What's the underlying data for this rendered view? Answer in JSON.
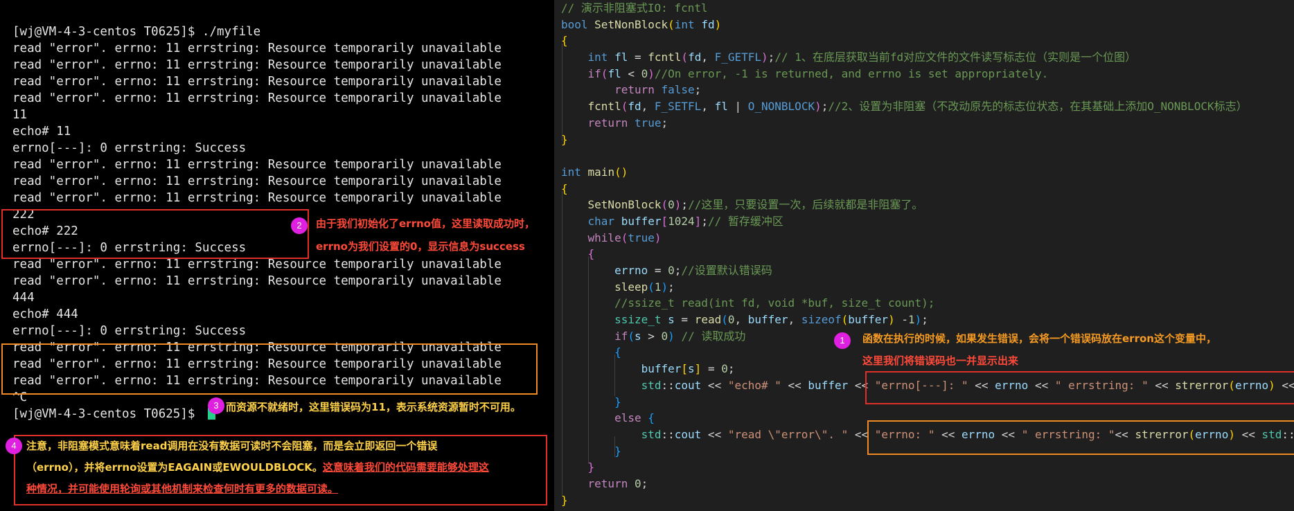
{
  "terminal": {
    "lines": [
      "[wj@VM-4-3-centos T0625]$ ./myfile",
      "read \"error\". errno: 11 errstring: Resource temporarily unavailable",
      "read \"error\". errno: 11 errstring: Resource temporarily unavailable",
      "read \"error\". errno: 11 errstring: Resource temporarily unavailable",
      "read \"error\". errno: 11 errstring: Resource temporarily unavailable",
      "11",
      "echo# 11",
      "errno[---]: 0 errstring: Success",
      "read \"error\". errno: 11 errstring: Resource temporarily unavailable",
      "read \"error\". errno: 11 errstring: Resource temporarily unavailable",
      "read \"error\". errno: 11 errstring: Resource temporarily unavailable",
      "222",
      "echo# 222",
      "errno[---]: 0 errstring: Success",
      "read \"error\". errno: 11 errstring: Resource temporarily unavailable",
      "read \"error\". errno: 11 errstring: Resource temporarily unavailable",
      "444",
      "echo# 444",
      "errno[---]: 0 errstring: Success",
      "read \"error\". errno: 11 errstring: Resource temporarily unavailable",
      "read \"error\". errno: 11 errstring: Resource temporarily unavailable",
      "read \"error\". errno: 11 errstring: Resource temporarily unavailable",
      "^C",
      "[wj@VM-4-3-centos T0625]$ "
    ]
  },
  "code": {
    "lines": [
      [
        [
          "cm",
          "// 演示非阻塞式IO: fcntl"
        ]
      ],
      [
        [
          "kw",
          "bool"
        ],
        [
          "t",
          " "
        ],
        [
          "fn",
          "SetNonBlock"
        ],
        [
          "br1",
          "("
        ],
        [
          "kw",
          "int"
        ],
        [
          "t",
          " "
        ],
        [
          "var",
          "fd"
        ],
        [
          "br1",
          ")"
        ]
      ],
      [
        [
          "br1",
          "{"
        ]
      ],
      [
        [
          "t",
          "    "
        ],
        [
          "kw",
          "int"
        ],
        [
          "t",
          " "
        ],
        [
          "var",
          "fl"
        ],
        [
          "t",
          " = "
        ],
        [
          "fn",
          "fcntl"
        ],
        [
          "br2",
          "("
        ],
        [
          "var",
          "fd"
        ],
        [
          "t",
          ", "
        ],
        [
          "mac",
          "F_GETFL"
        ],
        [
          "br2",
          ")"
        ],
        [
          "t",
          ";"
        ],
        [
          "cm",
          "// 1、在底层获取当前fd对应文件的文件读写标志位（实则是一个位图）"
        ]
      ],
      [
        [
          "t",
          "    "
        ],
        [
          "ctl",
          "if"
        ],
        [
          "br2",
          "("
        ],
        [
          "var",
          "fl"
        ],
        [
          "t",
          " < "
        ],
        [
          "num",
          "0"
        ],
        [
          "br2",
          ")"
        ],
        [
          "cm",
          "//On error, -1 is returned, and errno is set appropriately."
        ]
      ],
      [
        [
          "t",
          "        "
        ],
        [
          "ctl",
          "return"
        ],
        [
          "t",
          " "
        ],
        [
          "kw",
          "false"
        ],
        [
          "t",
          ";"
        ]
      ],
      [
        [
          "t",
          "    "
        ],
        [
          "fn",
          "fcntl"
        ],
        [
          "br2",
          "("
        ],
        [
          "var",
          "fd"
        ],
        [
          "t",
          ", "
        ],
        [
          "mac",
          "F_SETFL"
        ],
        [
          "t",
          ", "
        ],
        [
          "var",
          "fl"
        ],
        [
          "t",
          " | "
        ],
        [
          "mac",
          "O_NONBLOCK"
        ],
        [
          "br2",
          ")"
        ],
        [
          "t",
          ";"
        ],
        [
          "cm",
          "//2、设置为非阻塞（不改动原先的标志位状态，在其基础上添加O_NONBLOCK标志）"
        ]
      ],
      [
        [
          "t",
          "    "
        ],
        [
          "ctl",
          "return"
        ],
        [
          "t",
          " "
        ],
        [
          "kw",
          "true"
        ],
        [
          "t",
          ";"
        ]
      ],
      [
        [
          "br1",
          "}"
        ]
      ],
      [
        [
          "t",
          ""
        ]
      ],
      [
        [
          "kw",
          "int"
        ],
        [
          "t",
          " "
        ],
        [
          "fn",
          "main"
        ],
        [
          "br1",
          "()"
        ]
      ],
      [
        [
          "br1",
          "{"
        ]
      ],
      [
        [
          "t",
          "    "
        ],
        [
          "fn",
          "SetNonBlock"
        ],
        [
          "br2",
          "("
        ],
        [
          "num",
          "0"
        ],
        [
          "br2",
          ")"
        ],
        [
          "t",
          ";"
        ],
        [
          "cm",
          "//这里，只要设置一次，后续就都是非阻塞了。"
        ]
      ],
      [
        [
          "t",
          "    "
        ],
        [
          "kw",
          "char"
        ],
        [
          "t",
          " "
        ],
        [
          "var",
          "buffer"
        ],
        [
          "br2",
          "["
        ],
        [
          "num",
          "1024"
        ],
        [
          "br2",
          "]"
        ],
        [
          "t",
          ";"
        ],
        [
          "cm",
          "// 暂存缓冲区"
        ]
      ],
      [
        [
          "t",
          "    "
        ],
        [
          "ctl",
          "while"
        ],
        [
          "br2",
          "("
        ],
        [
          "kw",
          "true"
        ],
        [
          "br2",
          ")"
        ]
      ],
      [
        [
          "t",
          "    "
        ],
        [
          "br2",
          "{"
        ]
      ],
      [
        [
          "t",
          "        "
        ],
        [
          "var",
          "errno"
        ],
        [
          "t",
          " = "
        ],
        [
          "num",
          "0"
        ],
        [
          "t",
          ";"
        ],
        [
          "cm",
          "//设置默认错误码"
        ]
      ],
      [
        [
          "t",
          "        "
        ],
        [
          "fn",
          "sleep"
        ],
        [
          "br3",
          "("
        ],
        [
          "num",
          "1"
        ],
        [
          "br3",
          ")"
        ],
        [
          "t",
          ";"
        ]
      ],
      [
        [
          "t",
          "        "
        ],
        [
          "cm",
          "//ssize_t read(int fd, void *buf, size_t count);"
        ]
      ],
      [
        [
          "t",
          "        "
        ],
        [
          "ty",
          "ssize_t"
        ],
        [
          "t",
          " "
        ],
        [
          "var",
          "s"
        ],
        [
          "t",
          " = "
        ],
        [
          "fn",
          "read"
        ],
        [
          "br3",
          "("
        ],
        [
          "num",
          "0"
        ],
        [
          "t",
          ", "
        ],
        [
          "var",
          "buffer"
        ],
        [
          "t",
          ", "
        ],
        [
          "kw",
          "sizeof"
        ],
        [
          "br1",
          "("
        ],
        [
          "var",
          "buffer"
        ],
        [
          "br1",
          ")"
        ],
        [
          "t",
          " -"
        ],
        [
          "num",
          "1"
        ],
        [
          "br3",
          ")"
        ],
        [
          "t",
          ";"
        ]
      ],
      [
        [
          "t",
          "        "
        ],
        [
          "ctl",
          "if"
        ],
        [
          "br3",
          "("
        ],
        [
          "var",
          "s"
        ],
        [
          "t",
          " > "
        ],
        [
          "num",
          "0"
        ],
        [
          "br3",
          ")"
        ],
        [
          "t",
          " "
        ],
        [
          "cm",
          "// 读取成功"
        ]
      ],
      [
        [
          "t",
          "        "
        ],
        [
          "br3",
          "{"
        ]
      ],
      [
        [
          "t",
          "            "
        ],
        [
          "var",
          "buffer"
        ],
        [
          "br1",
          "["
        ],
        [
          "var",
          "s"
        ],
        [
          "br1",
          "]"
        ],
        [
          "t",
          " = "
        ],
        [
          "num",
          "0"
        ],
        [
          "t",
          ";"
        ]
      ],
      [
        [
          "t",
          "            "
        ],
        [
          "ty",
          "std"
        ],
        [
          "t",
          "::"
        ],
        [
          "var",
          "cout"
        ],
        [
          "t",
          " << "
        ],
        [
          "str",
          "\"echo# \""
        ],
        [
          "t",
          " << "
        ],
        [
          "var",
          "buffer"
        ],
        [
          "t",
          " << "
        ],
        [
          "str",
          "\"errno[---]: \""
        ],
        [
          "t",
          " << "
        ],
        [
          "var",
          "errno"
        ],
        [
          "t",
          " << "
        ],
        [
          "str",
          "\" errstring: \""
        ],
        [
          "t",
          " << "
        ],
        [
          "fn",
          "strerror"
        ],
        [
          "br1",
          "("
        ],
        [
          "var",
          "errno"
        ],
        [
          "br1",
          ")"
        ],
        [
          "t",
          " <<"
        ]
      ],
      [
        [
          "t",
          "        "
        ],
        [
          "br3",
          "}"
        ]
      ],
      [
        [
          "t",
          "        "
        ],
        [
          "ctl",
          "else"
        ],
        [
          "t",
          " "
        ],
        [
          "br3",
          "{"
        ]
      ],
      [
        [
          "t",
          "            "
        ],
        [
          "ty",
          "std"
        ],
        [
          "t",
          "::"
        ],
        [
          "var",
          "cout"
        ],
        [
          "t",
          " << "
        ],
        [
          "str",
          "\"read \\\"error\\\". \""
        ],
        [
          "t",
          " << "
        ],
        [
          "str",
          "\"errno: \""
        ],
        [
          "t",
          " << "
        ],
        [
          "var",
          "errno"
        ],
        [
          "t",
          " << "
        ],
        [
          "str",
          "\" errstring: \""
        ],
        [
          "t",
          "<< "
        ],
        [
          "fn",
          "strerror"
        ],
        [
          "br1",
          "("
        ],
        [
          "var",
          "errno"
        ],
        [
          "br1",
          ")"
        ],
        [
          "t",
          " << "
        ],
        [
          "ty",
          "std"
        ],
        [
          "t",
          "::"
        ]
      ],
      [
        [
          "t",
          "        "
        ],
        [
          "br3",
          "}"
        ]
      ],
      [
        [
          "t",
          "    "
        ],
        [
          "br2",
          "}"
        ]
      ],
      [
        [
          "t",
          "    "
        ],
        [
          "ctl",
          "return"
        ],
        [
          "t",
          " "
        ],
        [
          "num",
          "0"
        ],
        [
          "t",
          ";"
        ]
      ],
      [
        [
          "br1",
          "}"
        ]
      ]
    ]
  },
  "annotations": {
    "badge1": "1",
    "badge2": "2",
    "badge3": "3",
    "badge4": "4",
    "note1_line1": "函数在执行的时候，如果发生错误，会将一个错误码放在erron这个变量中，",
    "note1_line2": "这里我们将错误码也一并显示出来",
    "note2_line1": "由于我们初始化了errno值，这里读取成功时，",
    "note2_line2": "errno为我们设置的0，显示信息为success",
    "note3": "而资源不就绪时，这里错误码为11，表示系统资源暂时不可用。",
    "note4_line1": "注意，非阻塞模式意味着read调用在没有数据可读时不会阻塞，而是会立即返回一个错误",
    "note4_line2a": "（errno），并将errno设置为EAGAIN或EWOULDBLOCK。",
    "note4_line2b": "这意味着我们的代码需要能够处理这",
    "note4_line3": "种情况，并可能使用轮询或其他机制来检查何时有更多的数据可读。"
  },
  "colors": {
    "terminal_bg": "#000000",
    "editor_bg": "#1f1f1f",
    "highlight_red": "#e0302a",
    "highlight_orange": "#f08a24",
    "badge": "#e020e0",
    "cursor": "#23d18b"
  }
}
